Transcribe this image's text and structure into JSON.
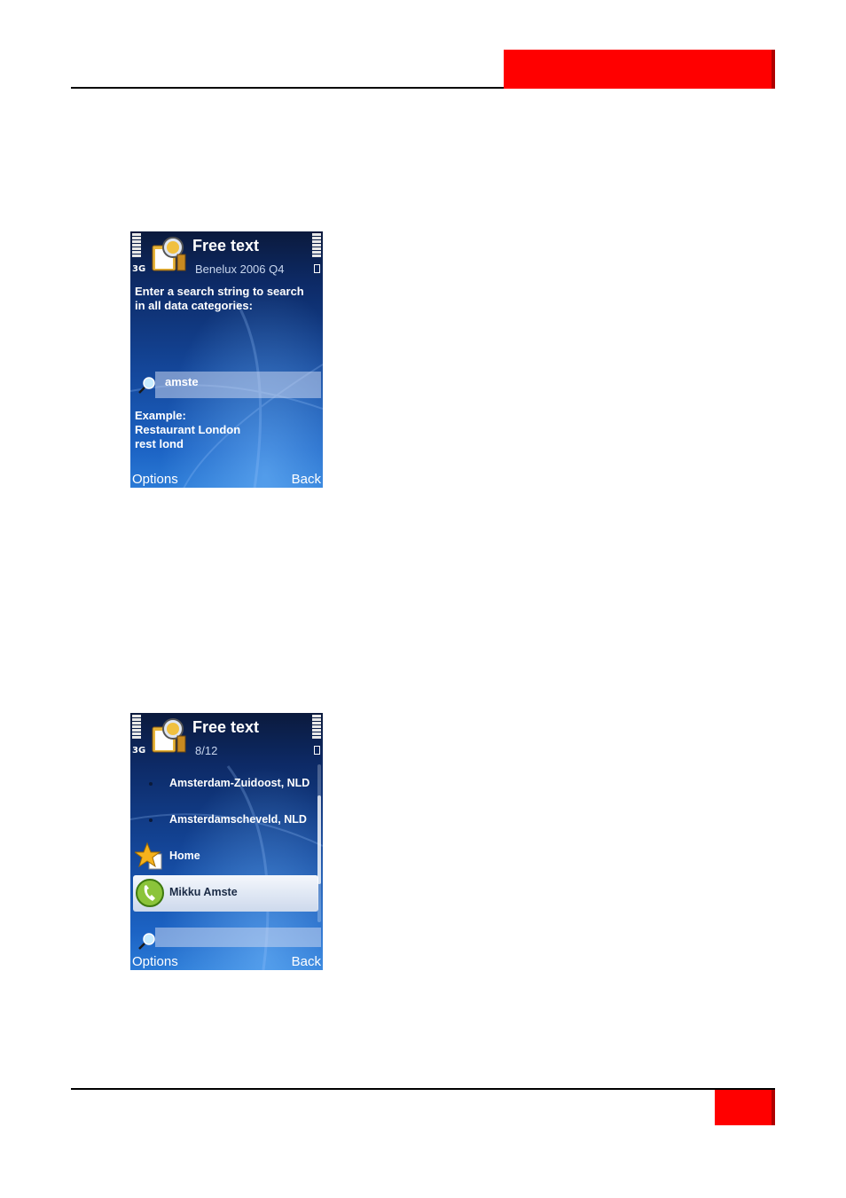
{
  "colors": {
    "brand_red": "#ff0000",
    "screen_blue": "#14479b",
    "selection": "#cdd9ec"
  },
  "screen1": {
    "net": "3G",
    "title": "Free text",
    "subtitle": "Benelux 2006 Q4",
    "prompt_line1": "Enter a search string to search",
    "prompt_line2": "in all data categories:",
    "search_value": "amste",
    "example_line1": "Example:",
    "example_line2": "Restaurant London",
    "example_line3": "rest lond",
    "left_softkey": "Options",
    "right_softkey": "Back",
    "icons": {
      "app": "folder-globe-icon",
      "search": "magnifier-icon"
    }
  },
  "screen2": {
    "net": "3G",
    "title": "Free text",
    "subtitle": "8/12",
    "items": [
      {
        "label": "Amsterdam-Zuidoost, NLD",
        "icon": "bullet-icon"
      },
      {
        "label": "Amsterdamscheveld, NLD",
        "icon": "bullet-icon"
      },
      {
        "label": "Home",
        "icon": "star-icon"
      },
      {
        "label": "Mikku Amste",
        "icon": "phone-contact-icon",
        "selected": true
      }
    ],
    "search_value": "",
    "scroll_position": 0.45,
    "left_softkey": "Options",
    "right_softkey": "Back"
  }
}
